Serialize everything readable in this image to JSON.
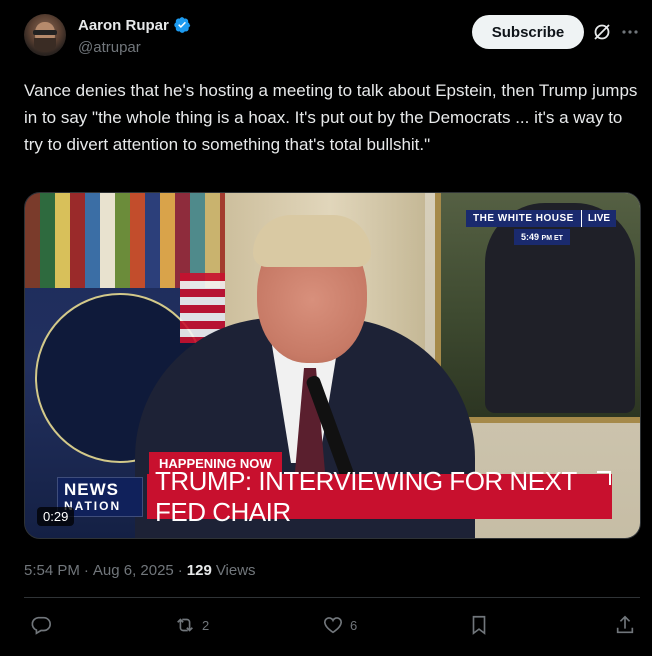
{
  "author": {
    "display_name": "Aaron Rupar",
    "handle": "@atrupar",
    "verified": true
  },
  "header": {
    "subscribe_label": "Subscribe"
  },
  "tweet": {
    "text": "Vance denies that he's hosting a meeting to talk about Epstein, then Trump jumps in to say \"the whole thing is a hoax. It's put out by the Democrats ... it's a way to try to divert attention to something that's total bullshit.\""
  },
  "video": {
    "channel_bug": "THE WHITE HOUSE",
    "live_label": "LIVE",
    "broadcast_time": "5:49",
    "broadcast_tz": "PM ET",
    "happening_label": "HAPPENING NOW",
    "headline": "TRUMP: INTERVIEWING FOR NEXT FED CHAIR",
    "network_top": "NEWS",
    "network_bottom": "NATION",
    "duration": "0:29"
  },
  "meta": {
    "time": "5:54 PM",
    "date": "Aug 6, 2025",
    "views_count": "129",
    "views_label": "Views",
    "separator": "·"
  },
  "actions": {
    "reply": {
      "icon": "reply-icon",
      "count": ""
    },
    "repost": {
      "icon": "repost-icon",
      "count": "2"
    },
    "like": {
      "icon": "heart-icon",
      "count": "6"
    },
    "bookmark": {
      "icon": "bookmark-icon",
      "count": ""
    },
    "share": {
      "icon": "share-icon",
      "count": ""
    }
  },
  "colors": {
    "background": "#000000",
    "text_primary": "#e7e9ea",
    "text_secondary": "#71767b",
    "verified_blue": "#1d9bf0",
    "lower_third_red": "#c8102e",
    "network_blue": "#1a2a6e"
  }
}
